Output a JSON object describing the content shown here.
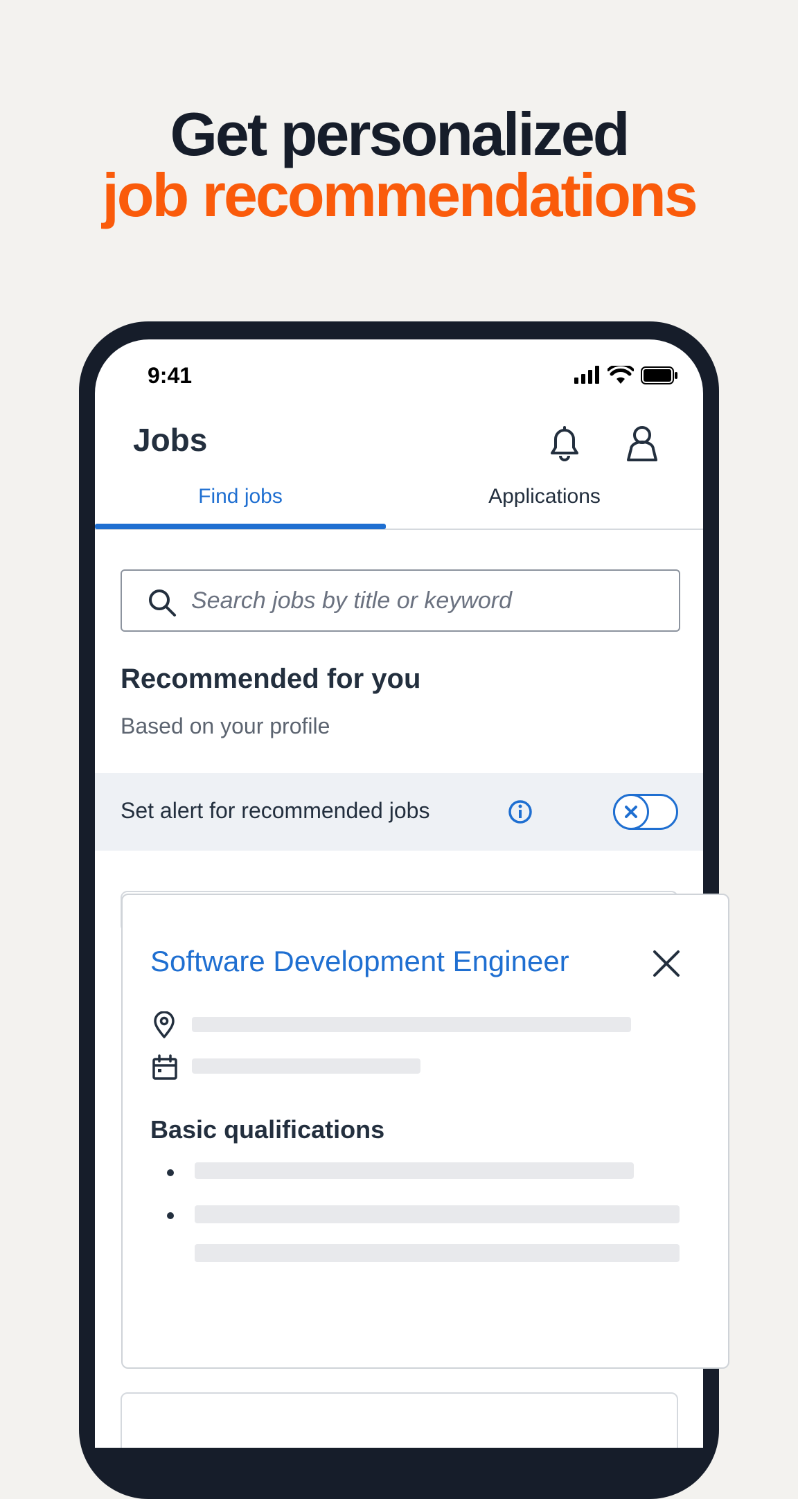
{
  "hero": {
    "line1": "Get personalized",
    "line2": "job recommendations",
    "line1_color": "#161d2a",
    "line2_color": "#fa5b0b"
  },
  "status_bar": {
    "time": "9:41",
    "icons": [
      "signal-icon",
      "wifi-icon",
      "battery-icon"
    ]
  },
  "header": {
    "title": "Jobs",
    "icons": [
      "bell-icon",
      "person-icon"
    ]
  },
  "tabs": [
    {
      "label": "Find jobs",
      "active": true
    },
    {
      "label": "Applications",
      "active": false
    }
  ],
  "search": {
    "placeholder": "Search jobs by title or keyword",
    "value": ""
  },
  "recommended": {
    "title": "Recommended for you",
    "subtitle": "Based on your profile"
  },
  "alert": {
    "label": "Set alert for recommended jobs",
    "toggle_on": false
  },
  "job_card": {
    "title": "Software Development Engineer",
    "section_title": "Basic qualifications"
  },
  "colors": {
    "accent": "#1f6fd1",
    "text": "#232f3e",
    "phone_frame": "#161d2a",
    "background": "#f3f2ef"
  }
}
